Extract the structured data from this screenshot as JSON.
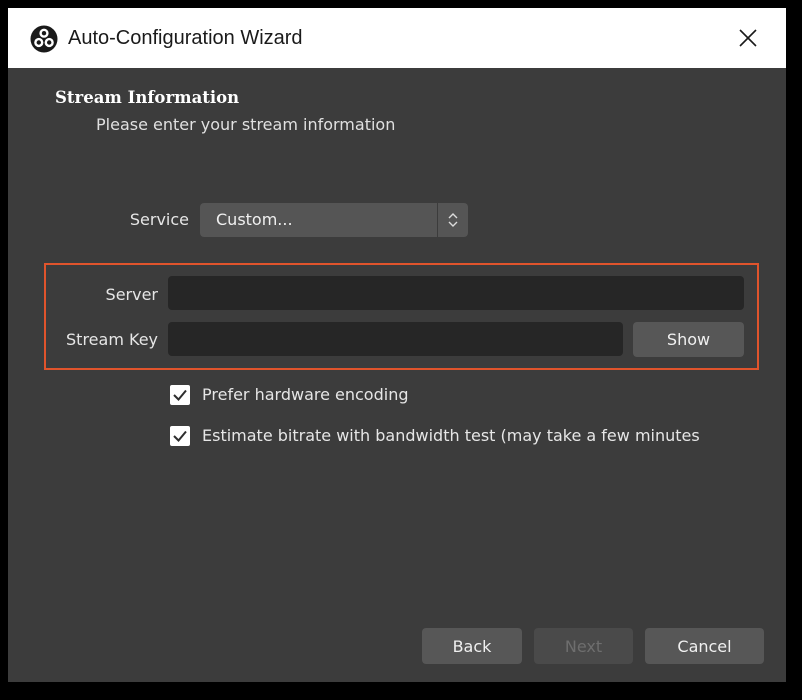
{
  "window": {
    "title": "Auto-Configuration Wizard",
    "icons": {
      "logo": "obs-logo-icon",
      "close": "close-icon"
    }
  },
  "section": {
    "title": "Stream Information",
    "subtitle": "Please enter your stream information"
  },
  "form": {
    "service_label": "Service",
    "service_value": "Custom...",
    "server_label": "Server",
    "server_value": "",
    "stream_key_label": "Stream Key",
    "stream_key_value": "",
    "show_button": "Show"
  },
  "options": [
    {
      "label": "Prefer hardware encoding",
      "checked": true
    },
    {
      "label": "Estimate bitrate with bandwidth test (may take a few minutes",
      "checked": true
    }
  ],
  "footer": {
    "back": "Back",
    "next": "Next",
    "cancel": "Cancel",
    "next_enabled": false
  },
  "colors": {
    "window_bg": "#3c3c3c",
    "titlebar_bg": "#ffffff",
    "highlight_border": "#e0542c",
    "input_bg": "#262626",
    "button_bg": "#575757"
  }
}
